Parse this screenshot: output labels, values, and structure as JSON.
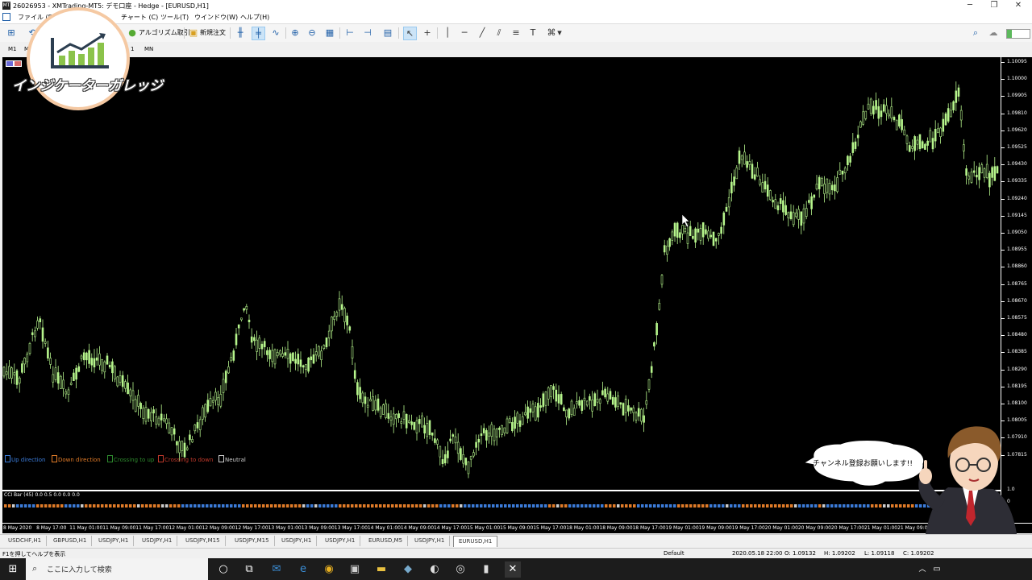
{
  "window": {
    "title": "26026953 - XMTrading-MT5: デモ口座 - Hedge - [EURUSD,H1]",
    "controls": [
      "─",
      "❐",
      "✕"
    ]
  },
  "menu": [
    "ファイル (F)",
    "チャート (C)",
    "ツール(T)",
    "ウインドウ(W)",
    "ヘルプ(H)"
  ],
  "toolbar": {
    "algo_trading": "アルゴリズム取引",
    "new_order": "新規注文"
  },
  "timeframes": [
    "M1",
    "M",
    "1",
    "MN"
  ],
  "logo": {
    "text": "インジケーターガレッジ"
  },
  "chart": {
    "symbol": "EURUSD,H1",
    "price_labels": [
      "1.10095",
      "1.10000",
      "1.09905",
      "1.09810",
      "1.09620",
      "1.09525",
      "1.09430",
      "1.09335",
      "1.09240",
      "1.09145",
      "1.09050",
      "1.08955",
      "1.08860",
      "1.08765",
      "1.08670",
      "1.08575",
      "1.08480",
      "1.08385",
      "1.08290",
      "1.08195",
      "1.08100",
      "1.08005",
      "1.07910",
      "1.07815"
    ],
    "indicator_scale": [
      "1.0",
      "0"
    ],
    "date_labels": [
      "8 May 2020",
      "8 May 17:00",
      "11 May 01:00",
      "11 May 09:00",
      "11 May 17:00",
      "12 May 01:00",
      "12 May 09:00",
      "12 May 17:00",
      "13 May 01:00",
      "13 May 09:00",
      "13 May 17:00",
      "14 May 01:00",
      "14 May 09:00",
      "14 May 17:00",
      "15 May 01:00",
      "15 May 09:00",
      "15 May 17:00",
      "18 May 01:00",
      "18 May 09:00",
      "18 May 17:00",
      "19 May 01:00",
      "19 May 09:00",
      "19 May 17:00",
      "20 May 01:00",
      "20 May 09:00",
      "20 May 17:00",
      "21 May 01:00",
      "21 May 09:00",
      "21 May 17:00",
      "22 May 01:00"
    ],
    "indicator_name": "CCI Bar (45) 0.0 0.5 0.0 0.0 0.0",
    "legend": [
      {
        "label": "Up direction",
        "color": "#3b7bd8"
      },
      {
        "label": "Down direction",
        "color": "#e07b28"
      },
      {
        "label": "Crossing to up",
        "color": "#2e8b2e"
      },
      {
        "label": "Crossing to down",
        "color": "#c0392b"
      },
      {
        "label": "Neutral",
        "color": "#cccccc"
      }
    ],
    "candle_color": "#b6f58c"
  },
  "chart_tabs": [
    "USDCHF,H1",
    "GBPUSD,H1",
    "USDJPY,H1",
    "USDJPY,H1",
    "USDJPY,M15",
    "USDJPY,M15",
    "USDJPY,H1",
    "USDJPY,H1",
    "EURUSD,M5",
    "USDJPY,H1",
    "EURUSD,H1"
  ],
  "status": {
    "help": "F1を押してヘルプを表示",
    "profile": "Default",
    "datetime": "2020.05.18 22:00",
    "open": "O: 1.09132",
    "high": "H: 1.09202",
    "low": "L: 1.09118",
    "close": "C: 1.09202"
  },
  "bubble": {
    "text": "チャンネル登録お願いします!!"
  },
  "taskbar": {
    "search_placeholder": "ここに入力して検索"
  }
}
